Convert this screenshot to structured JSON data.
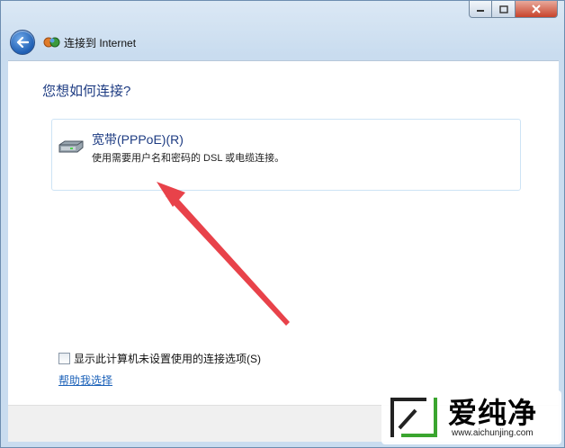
{
  "window": {
    "controls": {
      "minimize_icon": "minimize-icon",
      "maximize_icon": "maximize-icon",
      "close_icon": "close-icon"
    }
  },
  "nav": {
    "back_icon": "back-arrow-icon",
    "app_icon": "network-icon",
    "title": "连接到 Internet"
  },
  "main": {
    "question": "您想如何连接?",
    "option": {
      "icon": "modem-icon",
      "title": "宽带(PPPoE)(R)",
      "description": "使用需要用户名和密码的 DSL 或电缆连接。"
    },
    "checkbox": {
      "label": "显示此计算机未设置使用的连接选项(S)",
      "checked": false
    },
    "help_link": "帮助我选择"
  },
  "annotation": {
    "color": "#e8424a"
  },
  "watermark": {
    "text": "爱纯净",
    "url": "www.aichunjing.com"
  }
}
